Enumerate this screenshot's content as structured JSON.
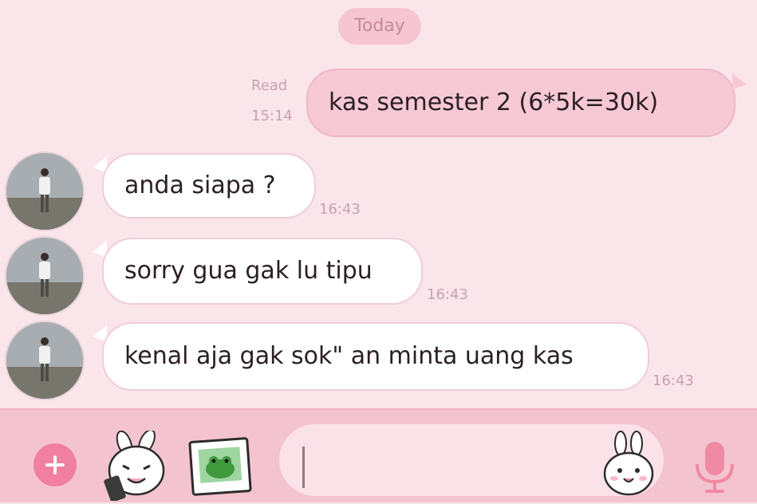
{
  "date_divider": "Today",
  "messages": [
    {
      "direction": "out",
      "text": "kas semester 2 (6*5k=30k)",
      "status": "Read",
      "time": "15:14"
    },
    {
      "direction": "in",
      "text": "anda siapa ?",
      "time": "16:43"
    },
    {
      "direction": "in",
      "text": "sorry gua gak lu tipu",
      "time": "16:43"
    },
    {
      "direction": "in",
      "text": "kenal aja gak sok\" an minta uang kas",
      "time": "16:43"
    }
  ],
  "composer": {
    "input_value": "",
    "icons": [
      "plus-icon",
      "sticker-icon",
      "photo-icon",
      "emoji-icon",
      "microphone-icon"
    ]
  },
  "colors": {
    "background": "#fae5eb",
    "outgoing_bubble": "#f7c9d5",
    "incoming_bubble": "#ffffff",
    "accent": "#f07fa0",
    "composer": "#f4c3d0"
  }
}
